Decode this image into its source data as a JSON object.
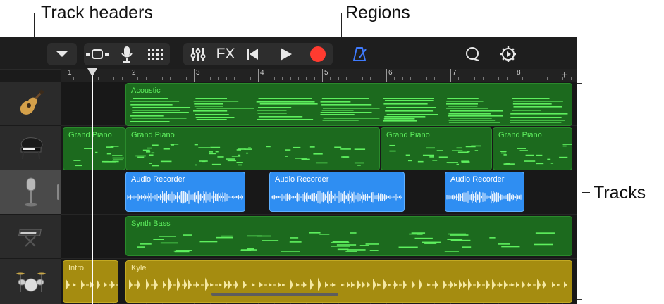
{
  "callouts": {
    "track_headers": "Track headers",
    "regions": "Regions",
    "tracks": "Tracks"
  },
  "toolbar": {
    "fx_label": "FX",
    "icons": [
      "chevron-down-icon",
      "view-toggle-icon",
      "microphone-icon",
      "grid-icon",
      "mixer-icon",
      "fx-icon",
      "rewind-icon",
      "play-icon",
      "record-icon",
      "metronome-icon",
      "loop-icon",
      "settings-icon"
    ],
    "colors": {
      "record": "#ff3b30",
      "metronome": "#3f7bff"
    }
  },
  "ruler": {
    "bars": [
      "1",
      "2",
      "3",
      "4",
      "5",
      "6",
      "7",
      "8"
    ],
    "add_label": "+"
  },
  "tracks": [
    {
      "instrument": "acoustic-guitar-icon",
      "regions": [
        {
          "name": "Acoustic"
        }
      ]
    },
    {
      "instrument": "grand-piano-icon",
      "regions": [
        {
          "name": "Grand Piano"
        },
        {
          "name": "Grand Piano"
        },
        {
          "name": "Grand Piano"
        },
        {
          "name": "Grand Piano"
        }
      ]
    },
    {
      "instrument": "microphone-icon",
      "regions": [
        {
          "name": "Audio Recorder"
        },
        {
          "name": "Audio Recorder"
        },
        {
          "name": "Audio Recorder"
        }
      ]
    },
    {
      "instrument": "synth-keyboard-icon",
      "regions": [
        {
          "name": "Synth Bass"
        }
      ]
    },
    {
      "instrument": "drum-kit-icon",
      "regions": [
        {
          "name": "Intro"
        },
        {
          "name": "Kyle"
        }
      ]
    }
  ],
  "colors": {
    "midi_region": "#1c6a1e",
    "audio_region": "#2f8ef2",
    "drummer_region": "#a58c10"
  }
}
